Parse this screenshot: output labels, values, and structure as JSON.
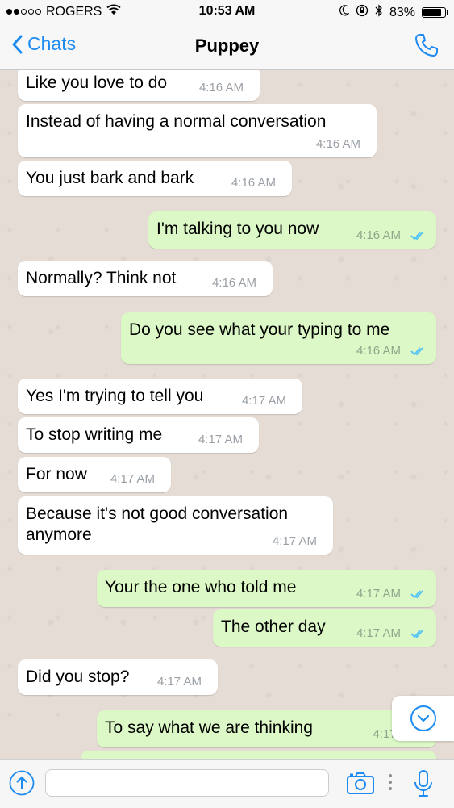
{
  "status_bar": {
    "carrier": "ROGERS",
    "time": "10:53 AM",
    "battery": "83%"
  },
  "nav": {
    "back_label": "Chats",
    "title": "Puppey"
  },
  "messages": [
    {
      "dir": "in",
      "text": "Like you love to do",
      "time": "4:16 AM"
    },
    {
      "dir": "in",
      "text": "Instead of having a normal conversation",
      "time": "4:16 AM"
    },
    {
      "dir": "in",
      "text": "You just bark and bark",
      "time": "4:16 AM"
    },
    {
      "dir": "out",
      "text": "I'm talking to you now",
      "time": "4:16 AM"
    },
    {
      "dir": "in",
      "text": "Normally? Think not",
      "time": "4:16 AM"
    },
    {
      "dir": "out",
      "text": "Do you see what your typing to me",
      "time": "4:16 AM"
    },
    {
      "dir": "in",
      "text": "Yes I'm trying to tell you",
      "time": "4:17 AM"
    },
    {
      "dir": "in",
      "text": "To stop writing me",
      "time": "4:17 AM"
    },
    {
      "dir": "in",
      "text": "For now",
      "time": "4:17 AM"
    },
    {
      "dir": "in",
      "text": "Because it's not good conversation anymore",
      "time": "4:17 AM"
    },
    {
      "dir": "out",
      "text": "Your the one who told me",
      "time": "4:17 AM"
    },
    {
      "dir": "out",
      "text": "The other day",
      "time": "4:17 AM"
    },
    {
      "dir": "in",
      "text": "Did you stop?",
      "time": "4:17 AM"
    },
    {
      "dir": "out",
      "text": "To say what we are thinking",
      "time": "4:17 A"
    }
  ],
  "input": {
    "value": "",
    "placeholder": ""
  },
  "colors": {
    "accent": "#1d8bf1",
    "incoming_bubble": "#ffffff",
    "outgoing_bubble": "#dcf8c6",
    "read_ticks": "#4fc3f7",
    "chat_background": "#e5ddd5"
  }
}
